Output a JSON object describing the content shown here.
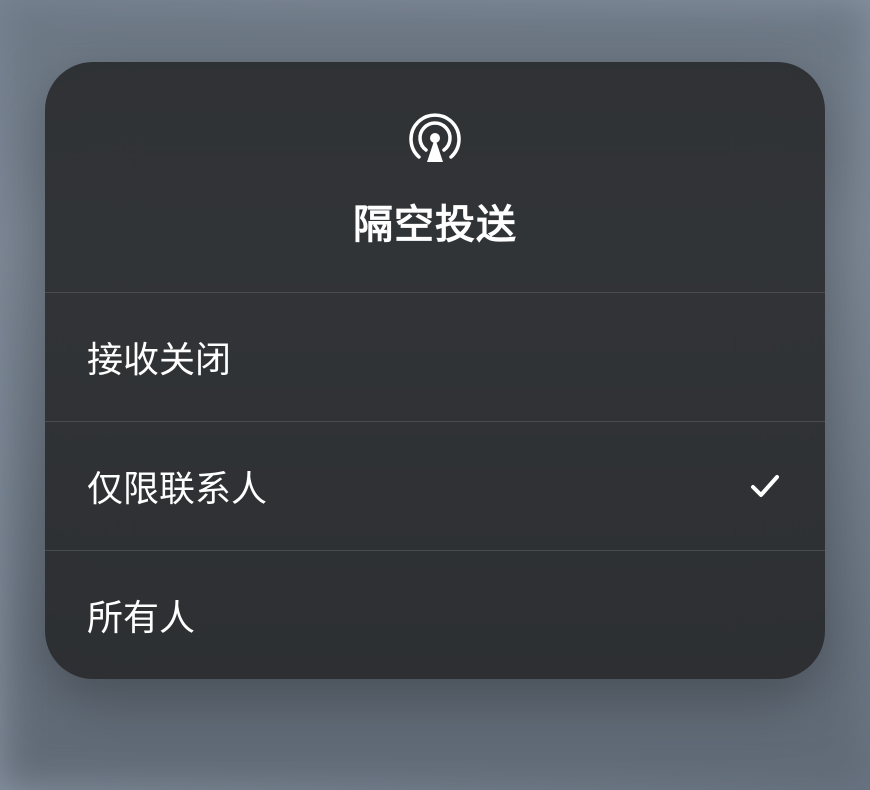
{
  "header": {
    "title": "隔空投送",
    "icon": "airdrop-icon"
  },
  "options": [
    {
      "label": "接收关闭",
      "selected": false
    },
    {
      "label": "仅限联系人",
      "selected": true
    },
    {
      "label": "所有人",
      "selected": false
    }
  ]
}
